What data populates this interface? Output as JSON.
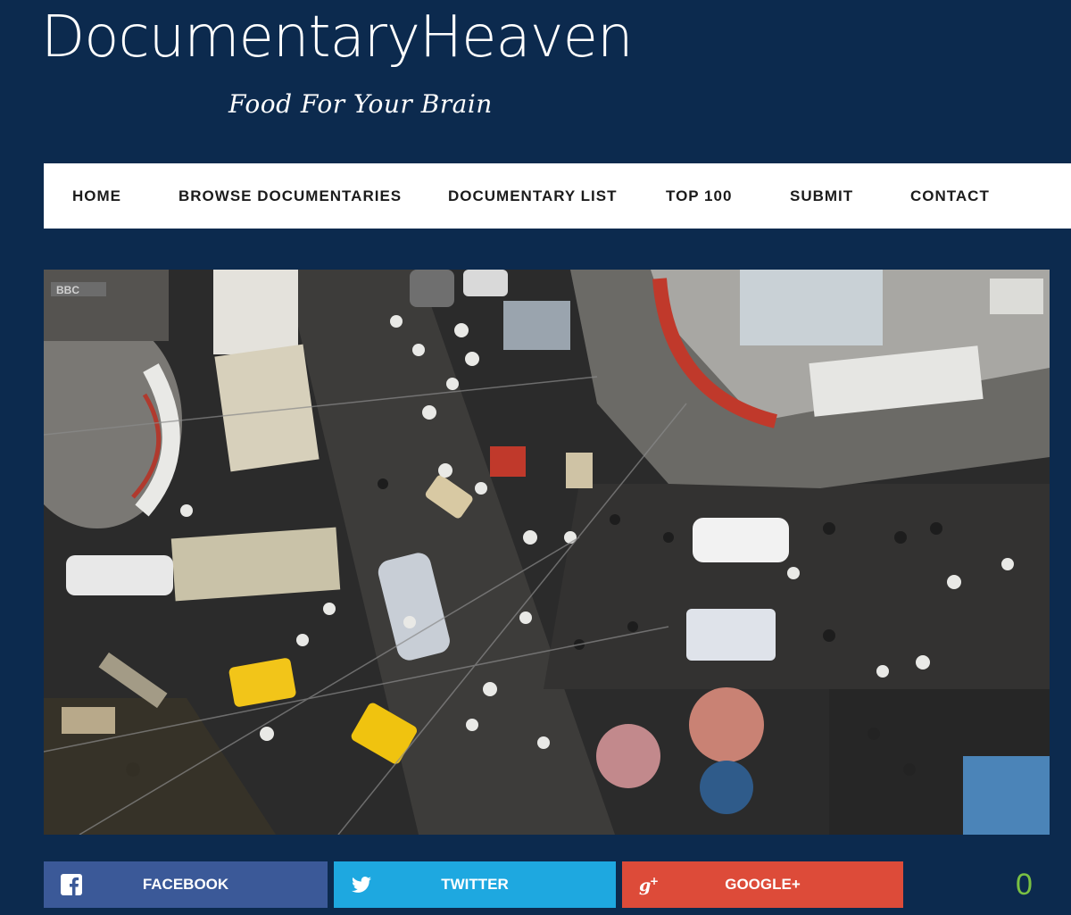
{
  "brand": {
    "title": "DocumentaryHeaven",
    "tagline": "Food For Your Brain"
  },
  "nav": {
    "items": [
      {
        "label": "HOME"
      },
      {
        "label": "BROWSE DOCUMENTARIES"
      },
      {
        "label": "DOCUMENTARY LIST"
      },
      {
        "label": "TOP 100"
      },
      {
        "label": "SUBMIT"
      },
      {
        "label": "CONTACT"
      }
    ]
  },
  "hero": {
    "watermark": "BBC"
  },
  "share": {
    "facebook": {
      "label": "FACEBOOK",
      "color": "#3b5998"
    },
    "twitter": {
      "label": "TWITTER",
      "color": "#1ea8e0"
    },
    "google": {
      "label": "GOOGLE+",
      "color": "#dd4b39"
    },
    "count": "0"
  },
  "colors": {
    "background": "#0c2a4e",
    "nav_background": "#ffffff",
    "count": "#7ac143"
  }
}
